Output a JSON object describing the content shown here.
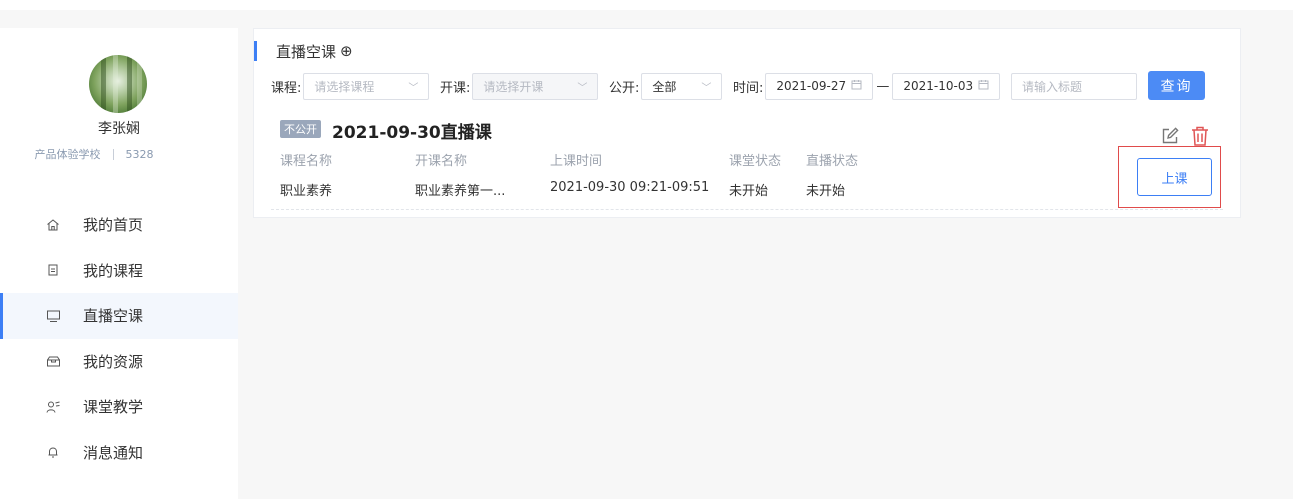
{
  "user": {
    "name": "李张娴",
    "school": "产品体验学校",
    "id": "5328"
  },
  "nav": [
    {
      "label": "我的首页",
      "icon": "home-icon",
      "active": false
    },
    {
      "label": "我的课程",
      "icon": "document-icon",
      "active": false
    },
    {
      "label": "直播空课",
      "icon": "monitor-icon",
      "active": true
    },
    {
      "label": "我的资源",
      "icon": "inbox-icon",
      "active": false
    },
    {
      "label": "课堂教学",
      "icon": "teacher-icon",
      "active": false
    },
    {
      "label": "消息通知",
      "icon": "bell-icon",
      "active": false
    }
  ],
  "panel": {
    "title": "直播空课",
    "add_symbol": "⊕"
  },
  "filters": {
    "course_label": "课程:",
    "course_placeholder": "请选择课程",
    "class_label": "开课:",
    "class_placeholder": "请选择开课",
    "public_label": "公开:",
    "public_value": "全部",
    "time_label": "时间:",
    "date_start": "2021-09-27",
    "date_end": "2021-10-03",
    "date_separator": "—",
    "title_placeholder": "请输入标题",
    "query_label": "查询"
  },
  "lesson": {
    "tag": "不公开",
    "title": "2021-09-30直播课",
    "headers": [
      "课程名称",
      "开课名称",
      "上课时间",
      "课堂状态",
      "直播状态"
    ],
    "values": [
      "职业素养",
      "职业素养第一...",
      "2021-09-30 09:21-09:51",
      "未开始",
      "未开始"
    ],
    "start_label": "上课"
  },
  "colors": {
    "accent": "#3d7ff5",
    "delete": "#e05555",
    "highlight": "#e04b4b",
    "tag": "#9aa7bb"
  }
}
